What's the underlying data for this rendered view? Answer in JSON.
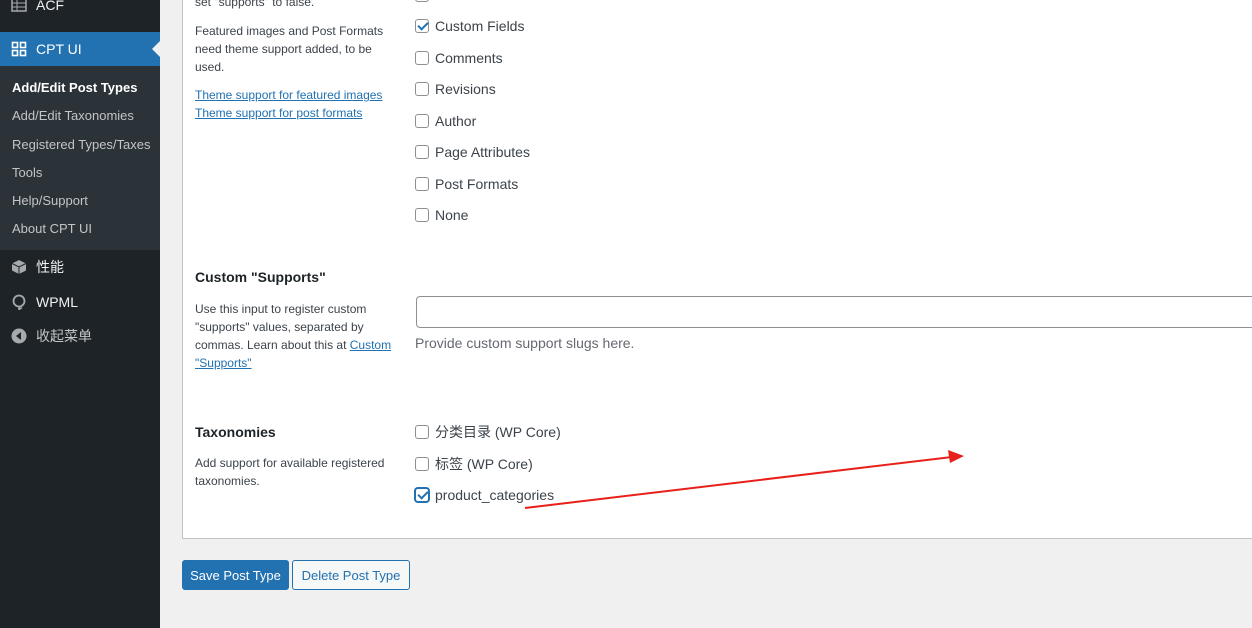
{
  "sidebar": {
    "menu": [
      {
        "label": "ACF",
        "icon": "table-icon"
      },
      {
        "label": "CPT UI",
        "icon": "grid-icon",
        "current": true
      },
      {
        "label": "性能",
        "icon": "cube-icon"
      },
      {
        "label": "WPML",
        "icon": "wpml-icon"
      },
      {
        "label": "收起菜单",
        "icon": "collapse-icon"
      }
    ],
    "submenu": [
      {
        "label": "Add/Edit Post Types",
        "active": true
      },
      {
        "label": "Add/Edit Taxonomies"
      },
      {
        "label": "Registered Types/Taxes"
      },
      {
        "label": "Tools"
      },
      {
        "label": "Help/Support"
      },
      {
        "label": "About CPT UI"
      }
    ]
  },
  "supports": {
    "cut_text": "set \"supports\" to false.",
    "note": "Featured images and Post Formats need theme support added, to be used.",
    "link_featured": "Theme support for featured images",
    "link_formats": "Theme support for post formats",
    "options": [
      {
        "label": "Custom Fields",
        "checked": true
      },
      {
        "label": "Comments",
        "checked": false
      },
      {
        "label": "Revisions",
        "checked": false
      },
      {
        "label": "Author",
        "checked": false
      },
      {
        "label": "Page Attributes",
        "checked": false
      },
      {
        "label": "Post Formats",
        "checked": false
      },
      {
        "label": "None",
        "checked": false
      }
    ]
  },
  "custom_supports": {
    "title": "Custom \"Supports\"",
    "desc_before_link": "Use this input to register custom \"supports\" values, separated by commas. Learn about this at ",
    "desc_link": "Custom \"Supports\"",
    "value": "",
    "hint": "Provide custom support slugs here."
  },
  "taxonomies": {
    "title": "Taxonomies",
    "desc": "Add support for available registered taxonomies.",
    "options": [
      {
        "label": "分类目录 (WP Core)",
        "checked": false
      },
      {
        "label": "标签 (WP Core)",
        "checked": false
      },
      {
        "label": "product_categories",
        "checked": true
      }
    ]
  },
  "buttons": {
    "save": "Save Post Type",
    "delete": "Delete Post Type"
  },
  "colors": {
    "sidebar_bg": "#1d2327",
    "accent": "#2271b1",
    "annotation_arrow": "#e8201a"
  }
}
